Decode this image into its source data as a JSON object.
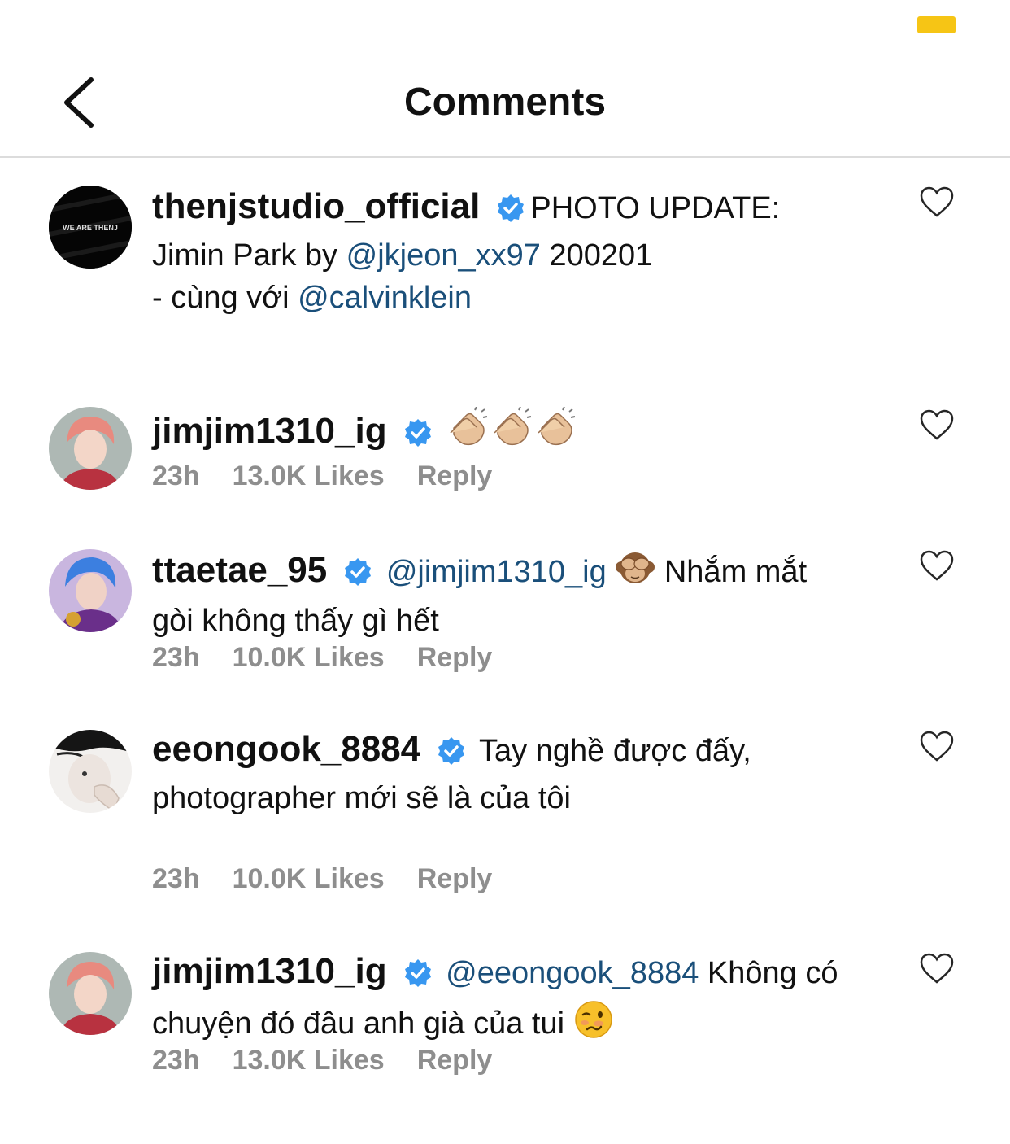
{
  "status_bar": {
    "battery_color": "#f6c515"
  },
  "header": {
    "title": "Comments",
    "back_icon": "chevron-left-icon"
  },
  "colors": {
    "mention": "#1a4f7a",
    "verified": "#3897f0",
    "meta": "#8e8e8e"
  },
  "caption": {
    "username": "thenjstudio_official",
    "text_1": "PHOTO UPDATE:",
    "text_2": "Jimin Park by ",
    "mention_1": "@jkjeon_xx97",
    "text_3": " 200201",
    "text_4": "- cùng với ",
    "mention_2": "@calvinklein",
    "avatar_text": "WE ARE THENJ"
  },
  "comments": [
    {
      "username": "jimjim1310_ig",
      "emojis": "clapping-hands x3",
      "time": "23h",
      "likes": "13.0K Likes",
      "reply": "Reply"
    },
    {
      "username": "ttaetae_95",
      "mention": "@jimjim1310_ig",
      "emoji": "see-no-evil-monkey",
      "text_1": "Nhắm mắt",
      "text_2": "gòi không thấy gì hết",
      "time": "23h",
      "likes": "10.0K Likes",
      "reply": "Reply"
    },
    {
      "username": "eeongook_8884",
      "text_1": "Tay nghề được đấy,",
      "text_2": "photographer mới sẽ là của tôi",
      "time": "23h",
      "likes": "10.0K Likes",
      "reply": "Reply"
    },
    {
      "username": "jimjim1310_ig",
      "mention": "@eeongook_8884",
      "text_1": "Không có",
      "text_2": "chuyện đó đâu anh già của tui",
      "emoji": "woozy-face",
      "time": "23h",
      "likes": "13.0K Likes",
      "reply": "Reply"
    }
  ]
}
